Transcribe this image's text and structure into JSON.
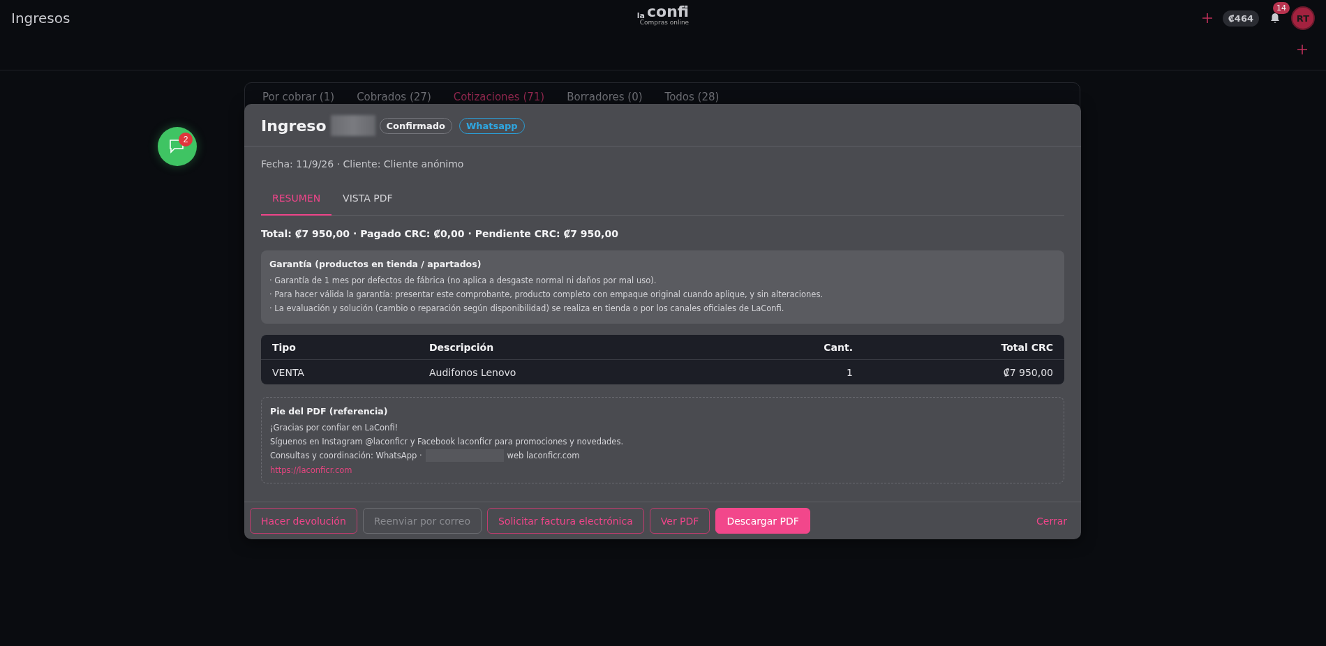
{
  "header": {
    "title": "Ingresos",
    "logo": {
      "prefix": "la",
      "name": "confi",
      "tagline": "Compras online"
    },
    "balance": "₡464",
    "notifications_badge": "14",
    "avatar_initials": "RT"
  },
  "chat_button": {
    "badge": "2"
  },
  "list_tabs": [
    {
      "label": "Por cobrar (1)",
      "selected": false
    },
    {
      "label": "Cobrados (27)",
      "selected": false
    },
    {
      "label": "Cotizaciones (71)",
      "selected": true
    },
    {
      "label": "Borradores (0)",
      "selected": false
    },
    {
      "label": "Todos (28)",
      "selected": false
    }
  ],
  "modal": {
    "title": "Ingreso",
    "badges": [
      {
        "label": "Confirmado",
        "kind": "status"
      },
      {
        "label": "Whatsapp",
        "kind": "channel"
      }
    ],
    "meta": "Fecha: 11/9/26 · Cliente: Cliente anónimo",
    "tabs": [
      {
        "label": "RESUMEN",
        "selected": true
      },
      {
        "label": "VISTA PDF",
        "selected": false
      }
    ],
    "totals": "Total: ₡7 950,00 · Pagado CRC: ₡0,00 · Pendiente CRC: ₡7 950,00",
    "warranty": {
      "title": "Garantía (productos en tienda / apartados)",
      "lines": [
        "· Garantía de 1 mes por defectos de fábrica (no aplica a desgaste normal ni daños por mal uso).",
        "· Para hacer válida la garantía: presentar este comprobante, producto completo con empaque original cuando aplique, y sin alteraciones.",
        "· La evaluación y solución (cambio o reparación según disponibilidad) se realiza en tienda o por los canales oficiales de LaConfi."
      ]
    },
    "table": {
      "columns": [
        "Tipo",
        "Descripción",
        "Cant.",
        "Total CRC"
      ],
      "rows": [
        [
          "VENTA",
          "Audifonos Lenovo",
          "1",
          "₡7 950,00"
        ]
      ]
    },
    "pdf_footer": {
      "title": "Pie del PDF (referencia)",
      "lines": [
        "¡Gracias por confiar en LaConfi!",
        "Síguenos en Instagram @laconficr y Facebook laconficr para promociones y novedades."
      ],
      "contact_prefix": "Consultas y coordinación: WhatsApp ·",
      "contact_suffix": "web laconficr.com",
      "link": "https://laconficr.com"
    },
    "actions": [
      {
        "label": "Hacer devolución",
        "kind": "outline",
        "disabled": false
      },
      {
        "label": "Reenviar por correo",
        "kind": "outline",
        "disabled": true
      },
      {
        "label": "Solicitar factura electrónica",
        "kind": "outline",
        "disabled": false
      },
      {
        "label": "Ver PDF",
        "kind": "outline",
        "disabled": false
      },
      {
        "label": "Descargar PDF",
        "kind": "primary",
        "disabled": false
      }
    ],
    "close": "Cerrar"
  }
}
